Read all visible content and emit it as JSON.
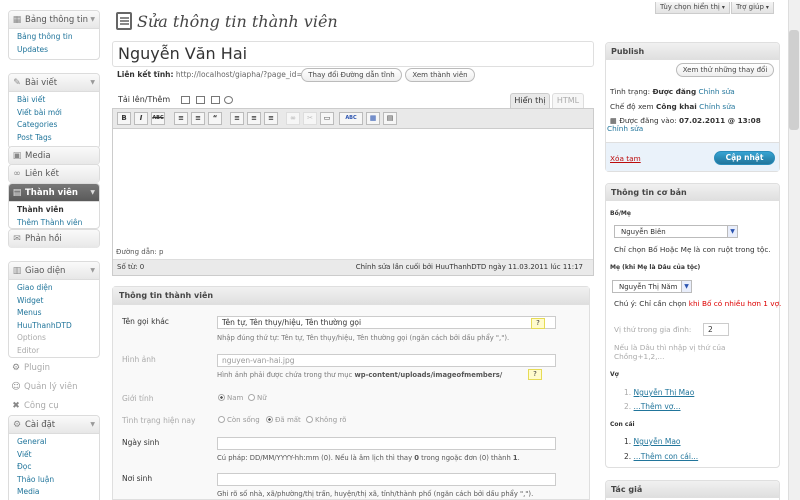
{
  "topbar": {
    "screen_options": "Tùy chọn hiển thị",
    "help": "Trợ giúp"
  },
  "sidebar": {
    "dashboard": {
      "label": "Bảng thông tin",
      "items": [
        "Bảng thông tin",
        "Updates"
      ]
    },
    "posts": {
      "label": "Bài viết",
      "items": [
        "Bài viết",
        "Viết bài mới",
        "Categories",
        "Post Tags"
      ]
    },
    "media": "Media",
    "links": "Liên kết",
    "members": {
      "label": "Thành viên",
      "items": [
        "Thành viên",
        "Thêm Thành viên"
      ]
    },
    "comments": "Phản hồi",
    "appearance": {
      "label": "Giao diện",
      "items": [
        "Giao diện",
        "Widget",
        "Menus",
        "HuuThanhDTD",
        "Options",
        "Editor"
      ]
    },
    "plugins": "Plugin",
    "users": "Quản lý viên",
    "tools": "Công cụ",
    "settings": {
      "label": "Cài đặt",
      "items": [
        "General",
        "Viết",
        "Đọc",
        "Thảo luận",
        "Media"
      ]
    }
  },
  "page": {
    "heading": "Sửa thông tin thành viên",
    "post_title": "Nguyễn Văn Hai"
  },
  "permalink": {
    "label": "Liên kết tĩnh:",
    "url": "http://localhost/giapha/?page_id=6",
    "change_btn": "Thay đổi Đường dẫn tĩnh",
    "view_btn": "Xem thành viên"
  },
  "editor": {
    "upload_label": "Tải lên/Thêm",
    "tab_visual": "Hiển thị",
    "tab_html": "HTML",
    "tools": [
      "B",
      "I",
      "ABC",
      "≡",
      "≡",
      "“",
      "≡",
      "≡",
      "≡",
      "∞",
      "✂",
      "▭",
      "ABC",
      "▦",
      "▤"
    ],
    "path": "Đường dẫn: p",
    "word_count": "Số từ: 0",
    "last_edit": "Chỉnh sửa lần cuối bởi HuuThanhDTD ngày 11.03.2011 lúc 11:17"
  },
  "member_info": {
    "title": "Thông tin thành viên",
    "alias": {
      "label": "Tên gọi khác",
      "value": "Tên tự, Tên thụy/hiệu, Tên thường gọi",
      "hint": "Nhập đúng thứ tự: Tên tự, Tên thụy/hiệu, Tên thường gọi (ngăn cách bởi dấu phẩy \",\")."
    },
    "image": {
      "label": "Hình ảnh",
      "value": "nguyen-van-hai.jpg",
      "hint_pre": "Hình ảnh phải được chứa trong thư mục ",
      "hint_path": "wp-content/uploads/imageofmembers/"
    },
    "gender": {
      "label": "Giới tính",
      "options": [
        "Nam",
        "Nữ"
      ],
      "selected": 0
    },
    "status": {
      "label": "Tình trạng hiện nay",
      "options": [
        "Còn sống",
        "Đã mất",
        "Không rõ"
      ],
      "selected": 1
    },
    "birthday": {
      "label": "Ngày sinh",
      "hint_pre": "Cú pháp: DD/MM/YYYY-hh:mm (0). Nếu là âm lịch thì thay ",
      "hint_bold": "0",
      "hint_mid": " trong ngoặc đơn (0) thành ",
      "hint_bold2": "1",
      "hint_end": "."
    },
    "birthplace": {
      "label": "Nơi sinh",
      "hint": "Ghi rõ số nhà, xã/phường/thị trấn, huyện/thị xã, tỉnh/thành phố (ngăn cách bởi dấu phẩy \",\")."
    }
  },
  "publish": {
    "title": "Publish",
    "preview_btn": "Xem thử những thay đổi",
    "status_label": "Tình trạng:",
    "status_value": "Được đăng",
    "edit": "Chỉnh sửa",
    "visibility_label": "Chế độ xem",
    "visibility_value": "Công khai",
    "published_label": "Được đăng vào:",
    "published_value": "07.02.2011 @ 13:08",
    "trash": "Xóa tạm",
    "update_btn": "Cập nhật"
  },
  "basic_info": {
    "title": "Thông tin cơ bản",
    "parent_label": "Bố/Mẹ",
    "parent_value": "Nguyễn Biên",
    "parent_hint": "Chỉ chọn Bố Hoặc Mẹ là con ruột trong tộc.",
    "mother_label": "Mẹ (khi Mẹ là Dâu của tộc)",
    "mother_value": "Nguyễn Thị Năm",
    "note_pre": "Chú ý: Chỉ cần chọn ",
    "note_red": "khi Bố có nhiều hơn 1 vợ.",
    "order_label": "Vị thứ trong gia đình:",
    "order_value": "2",
    "order_hint": "Nếu là Dâu thì nhập vị thứ của Chồng+1,2,...",
    "spouse_label": "Vợ",
    "spouses": [
      "Nguyễn Thị Mao",
      "...Thêm vợ..."
    ],
    "children_label": "Con cái",
    "children": [
      "Nguyễn Mao",
      "...Thêm con cái..."
    ]
  },
  "author": {
    "title": "Tác giả"
  },
  "colors": {
    "accent": "#21759b",
    "button_blue": "#298cba",
    "header_gray": "#dfdfdf"
  }
}
